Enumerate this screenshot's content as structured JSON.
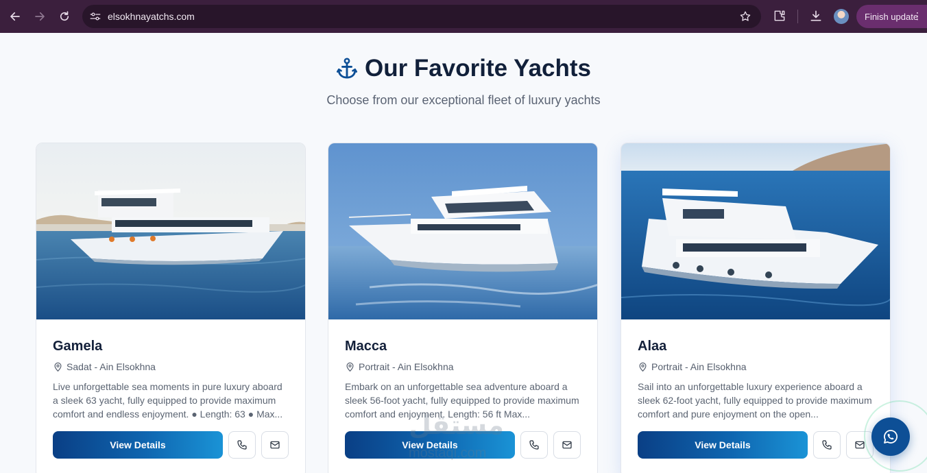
{
  "browser": {
    "url": "elsokhnayatchs.com",
    "update_label": "Finish update",
    "menu_glyph": "⋮"
  },
  "section": {
    "title": "Our Favorite Yachts",
    "subtitle": "Choose from our exceptional fleet of luxury yachts",
    "title_icon": "anchor-icon"
  },
  "cards": [
    {
      "name": "Gamela",
      "location": "Sadat - Ain Elsokhna",
      "description": "Live unforgettable sea moments in pure luxury aboard a sleek 63 yacht, fully equipped to provide maximum comfort and endless enjoyment. ● Length: 63 ● Max...",
      "button": "View Details"
    },
    {
      "name": "Macca",
      "location": "Portrait - Ain Elsokhna",
      "description": "Embark on an unforgettable sea adventure aboard a sleek 56-foot yacht, fully equipped to provide maximum comfort and enjoyment. Length: 56 ft Max...",
      "button": "View Details"
    },
    {
      "name": "Alaa",
      "location": "Portrait - Ain Elsokhna",
      "description": "Sail into an unforgettable luxury experience aboard a sleek 62-foot yacht, fully equipped to provide maximum comfort and pure enjoyment on the open...",
      "button": "View Details"
    }
  ],
  "watermark": {
    "logo": "مستقل",
    "text": "mostaql.com"
  },
  "colors": {
    "chrome": "#3b1f3d",
    "primary": "#0a3f85",
    "accent": "#1a93d6",
    "heading": "#11203a"
  }
}
